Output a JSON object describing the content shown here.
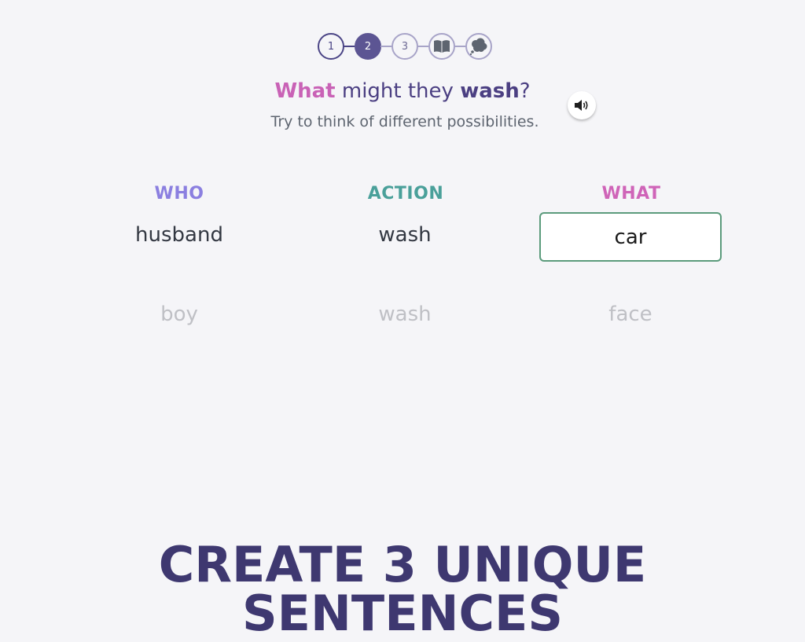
{
  "stepper": {
    "steps": [
      {
        "label": "1",
        "state": "done"
      },
      {
        "label": "2",
        "state": "active"
      },
      {
        "label": "3",
        "state": "future"
      }
    ],
    "extra_icons": [
      "book-icon",
      "thought-bubble-icon"
    ]
  },
  "question": {
    "part1": "What",
    "part2": " might they ",
    "part3": "wash",
    "part4": "?"
  },
  "subtitle": "Try to think of different possibilities.",
  "audio": {
    "icon": "speaker-icon"
  },
  "columns": {
    "who": {
      "header": "WHO",
      "color": "#8b7fe0",
      "current": "husband",
      "previous": "boy"
    },
    "action": {
      "header": "ACTION",
      "color": "#4aa09a",
      "current": "wash",
      "previous": "wash"
    },
    "what": {
      "header": "WHAT",
      "color": "#cf64b8",
      "current": "car",
      "previous": "face"
    }
  },
  "banner": "CREATE 3 UNIQUE SENTENCES"
}
